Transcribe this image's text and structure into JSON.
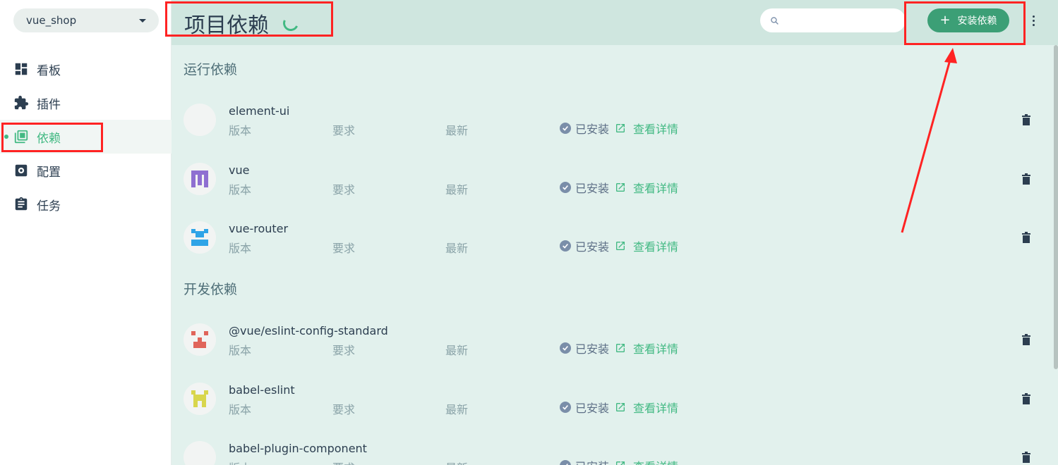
{
  "sidebar": {
    "project": "vue_shop",
    "items": [
      {
        "label": "看板",
        "icon": "dashboard-icon"
      },
      {
        "label": "插件",
        "icon": "puzzle-icon"
      },
      {
        "label": "依赖",
        "icon": "library-icon",
        "active": true
      },
      {
        "label": "配置",
        "icon": "settings-icon"
      },
      {
        "label": "任务",
        "icon": "clipboard-icon"
      }
    ]
  },
  "header": {
    "title": "项目依赖",
    "search_placeholder": "",
    "install_label": "安装依赖"
  },
  "sections": [
    {
      "title": "运行依赖"
    },
    {
      "title": "开发依赖"
    }
  ],
  "meta_labels": {
    "version": "版本",
    "required": "要求",
    "latest": "最新",
    "installed": "已安装",
    "details": "查看详情"
  },
  "dependencies": [
    {
      "name": "element-ui",
      "logo": "blank-logo"
    },
    {
      "name": "vue",
      "logo": "purple-pixel-logo"
    },
    {
      "name": "vue-router",
      "logo": "blue-pixel-logo"
    },
    {
      "name": "@vue/eslint-config-standard",
      "logo": "red-pixel-logo"
    },
    {
      "name": "babel-eslint",
      "logo": "yellow-pixel-logo"
    },
    {
      "name": "babel-plugin-component",
      "logo": "blank-logo"
    }
  ],
  "colors": {
    "accent": "#42b983",
    "button": "#3c9f76",
    "topbar": "#cfe6df",
    "content": "#e2f1ed",
    "annotation": "#ff2323"
  }
}
